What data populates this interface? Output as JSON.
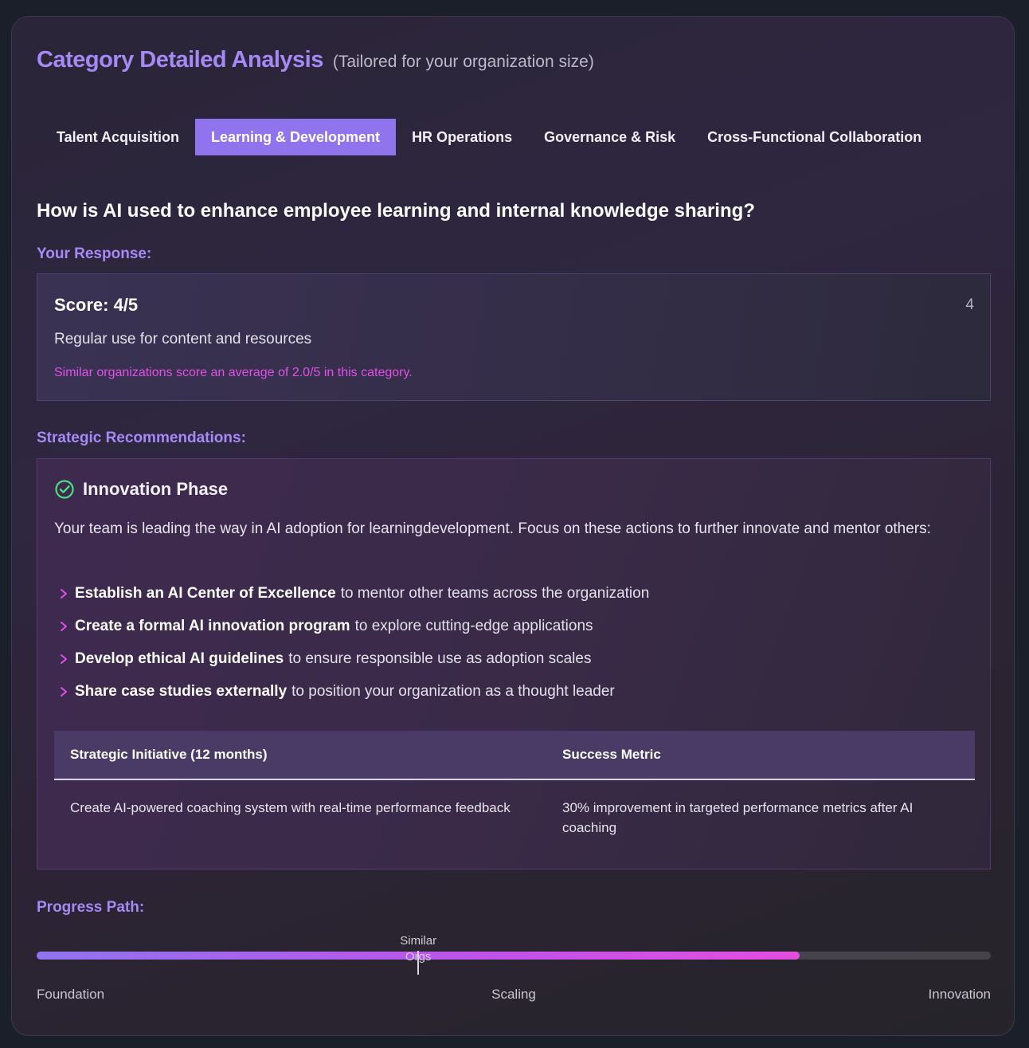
{
  "header": {
    "title": "Category Detailed Analysis",
    "subtitle": "(Tailored for your organization size)"
  },
  "tabs": [
    {
      "label": "Talent Acquisition",
      "active": false
    },
    {
      "label": "Learning & Development",
      "active": true
    },
    {
      "label": "HR Operations",
      "active": false
    },
    {
      "label": "Governance & Risk",
      "active": false
    },
    {
      "label": "Cross-Functional Collaboration",
      "active": false
    }
  ],
  "question": "How is AI used to enhance employee learning and internal knowledge sharing?",
  "response": {
    "label": "Your Response:",
    "score_text": "Score: 4/5",
    "score_value": "4",
    "answer": "Regular use for content and resources",
    "comparison": "Similar organizations score an average of 2.0/5 in this category."
  },
  "recommendations": {
    "label": "Strategic Recommendations:",
    "phase_title": "Innovation Phase",
    "phase_icon": "check-circle-icon",
    "description": "Your team is leading the way in AI adoption for learningdevelopment. Focus on these actions to further innovate and mentor others:",
    "actions": [
      {
        "bold": "Establish an AI Center of Excellence",
        "rest": "to mentor other teams across the organization"
      },
      {
        "bold": "Create a formal AI innovation program",
        "rest": "to explore cutting-edge applications"
      },
      {
        "bold": "Develop ethical AI guidelines",
        "rest": "to ensure responsible use as adoption scales"
      },
      {
        "bold": "Share case studies externally",
        "rest": "to position your organization as a thought leader"
      }
    ],
    "table": {
      "headers": [
        "Strategic Initiative (12 months)",
        "Success Metric"
      ],
      "rows": [
        [
          "Create AI-powered coaching system with real-time performance feedback",
          "30% improvement in targeted performance metrics after AI coaching"
        ]
      ]
    }
  },
  "progress": {
    "label": "Progress Path:",
    "marker_label": "Similar Orgs",
    "stages": [
      "Foundation",
      "Scaling",
      "Innovation"
    ],
    "value_percent": 80,
    "similar_orgs_percent": 40,
    "colors": {
      "start": "#8f74ee",
      "end": "#e54ee0",
      "track": "#45434c"
    }
  },
  "colors": {
    "accent": "#a589f5",
    "tab_active": "#8f74ee",
    "highlight": "#e050e6",
    "success": "#4ade80"
  }
}
